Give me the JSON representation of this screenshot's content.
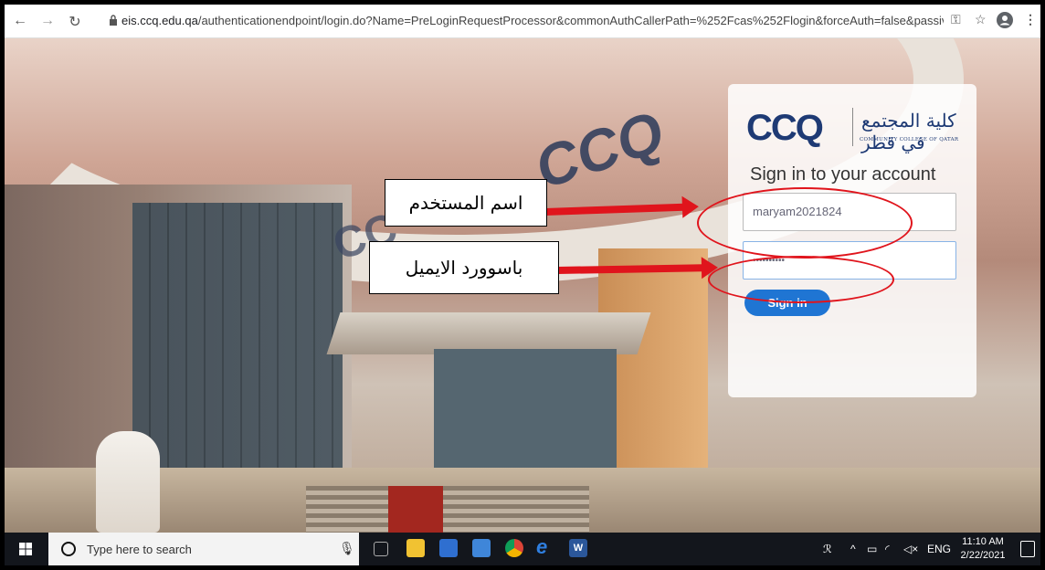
{
  "browser": {
    "back_icon": "arrow-left-icon",
    "forward_icon": "arrow-right-icon",
    "reload_icon": "reload-icon",
    "url_host": "eis.ccq.edu.qa",
    "url_path": "/authenticationendpoint/login.do?Name=PreLoginRequestProcessor&commonAuthCallerPath=%252Fcas%252Flogin&forceAuth=false&passive...",
    "key_icon": "key-icon",
    "star_icon": "star-icon",
    "profile_icon": "profile-icon",
    "menu_icon": "kebab-menu-icon"
  },
  "login": {
    "logo_text": "CCQ",
    "logo_arabic": "كلية المجتمع في قطر",
    "logo_english": "COMMUNITY COLLEGE OF QATAR",
    "title": "Sign in to your account",
    "username_value": "maryam2021824",
    "password_value": "••••••••••",
    "signin_label": "Sign in"
  },
  "annotations": {
    "username_note": "اسم المستخدم",
    "password_note": "باسوورد الايميل",
    "color": "#e0141c"
  },
  "taskbar": {
    "search_placeholder": "Type here to search",
    "lang": "ENG",
    "time": "11:10 AM",
    "date": "2/22/2021"
  }
}
